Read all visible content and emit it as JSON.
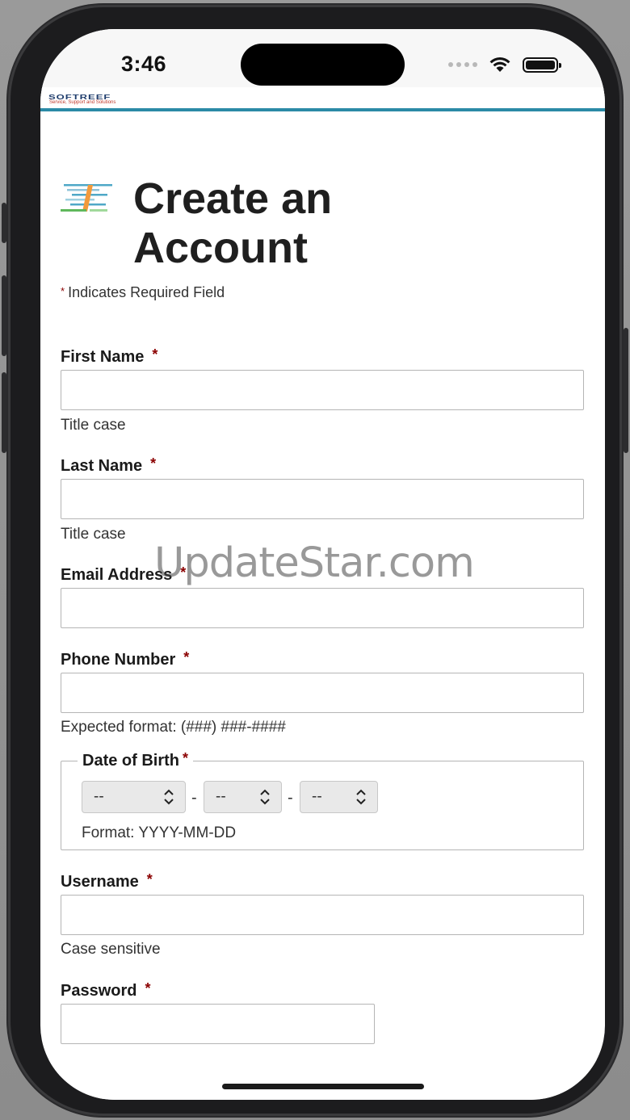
{
  "status_bar": {
    "time": "3:46"
  },
  "header": {
    "brand": "SOFTREEF",
    "tagline": "Service, Support and Solutions"
  },
  "page": {
    "title": "Create an Account",
    "required_note": "Indicates Required Field",
    "required_marker": "*"
  },
  "form": {
    "first_name": {
      "label": "First Name",
      "value": "",
      "help": "Title case"
    },
    "last_name": {
      "label": "Last Name",
      "value": "",
      "help": "Title case"
    },
    "email": {
      "label": "Email Address",
      "value": ""
    },
    "phone": {
      "label": "Phone Number",
      "value": "",
      "help": "Expected format: (###) ###-####"
    },
    "dob": {
      "legend": "Date of Birth",
      "year": "--",
      "month": "--",
      "day": "--",
      "separator": "-",
      "format": "Format: YYYY-MM-DD"
    },
    "username": {
      "label": "Username",
      "value": "",
      "help": "Case sensitive"
    },
    "password": {
      "label": "Password",
      "value": ""
    }
  },
  "watermark": "UpdateStar.com",
  "colors": {
    "accent_rule": "#2b8aa6",
    "required_star": "#8b0000",
    "title": "#1f1f1f"
  }
}
